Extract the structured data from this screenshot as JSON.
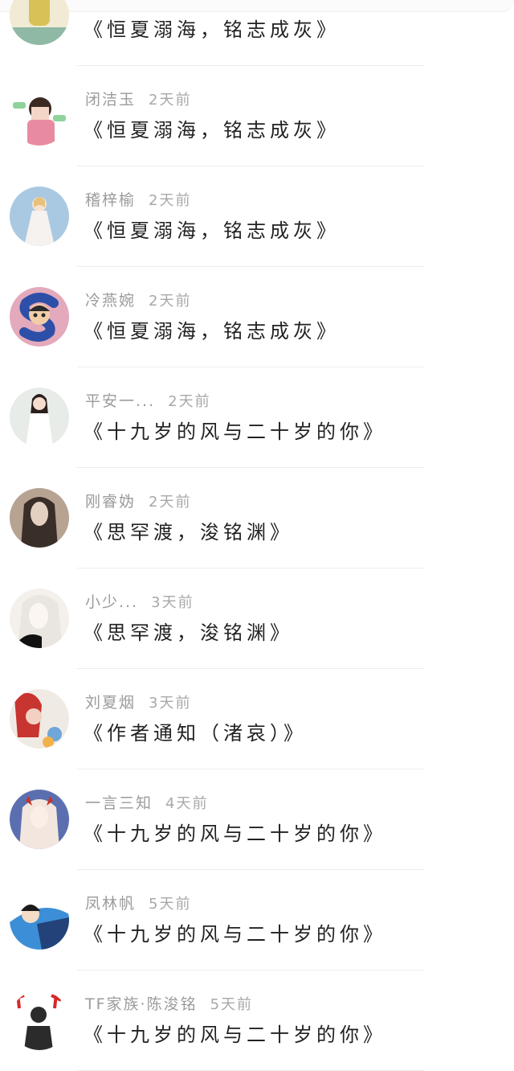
{
  "items": [
    {
      "name": "",
      "time": "",
      "title": "《恒夏溺海，铭志成灰》",
      "avatar": "green-shirt-person-avatar",
      "colors": [
        "#8fb9a4",
        "#d8c257",
        "#f1ead4"
      ]
    },
    {
      "name": "闭洁玉",
      "time": "2天前",
      "title": "《恒夏溺海，铭志成灰》",
      "avatar": "stickered-boy-avatar",
      "colors": [
        "#ffffff",
        "#e88aa0",
        "#3b2a22"
      ]
    },
    {
      "name": "稽梓榆",
      "time": "2天前",
      "title": "《恒夏溺海，铭志成灰》",
      "avatar": "anime-girl-white-dress-avatar",
      "colors": [
        "#a9c9e2",
        "#f5f2ef",
        "#e8c27d"
      ]
    },
    {
      "name": "冷燕婉",
      "time": "2天前",
      "title": "《恒夏溺海，铭志成灰》",
      "avatar": "cartoon-s-badge-avatar",
      "colors": [
        "#e3aabb",
        "#2d4fa8",
        "#2a2a2a"
      ]
    },
    {
      "name": "平安一...",
      "time": "2天前",
      "title": "《十九岁的风与二十岁的你》",
      "avatar": "woman-white-dress-avatar",
      "colors": [
        "#e8ece9",
        "#ffffff",
        "#2a1f1a"
      ]
    },
    {
      "name": "刚睿妫",
      "time": "2天前",
      "title": "《思罕渡，浚铭渊》",
      "avatar": "dark-hair-woman-avatar",
      "colors": [
        "#b7a392",
        "#3a2e29",
        "#e4d0c0"
      ]
    },
    {
      "name": "小少...",
      "time": "3天前",
      "title": "《思罕渡，浚铭渊》",
      "avatar": "white-hair-anime-avatar",
      "colors": [
        "#f4f1ec",
        "#e9e6e0",
        "#111111"
      ]
    },
    {
      "name": "刘夏烟",
      "time": "3天前",
      "title": "《作者通知（渚哀）》",
      "avatar": "red-hair-girl-avatar",
      "colors": [
        "#f0eae4",
        "#c8342f",
        "#6fa7d8"
      ]
    },
    {
      "name": "一言三知",
      "time": "4天前",
      "title": "《十九岁的风与二十岁的你》",
      "avatar": "fantasy-anime-girl-avatar",
      "colors": [
        "#5b6fb0",
        "#f3e6de",
        "#c8332b"
      ]
    },
    {
      "name": "凤林帆",
      "time": "5天前",
      "title": "《十九岁的风与二十岁的你》",
      "avatar": "detective-cartoon-avatar",
      "colors": [
        "#3c8fd6",
        "#24427a",
        "#ffffff"
      ]
    },
    {
      "name": "TF家族·陈浚铭",
      "time": "5天前",
      "title": "《十九岁的风与二十岁的你》",
      "avatar": "calligraphy-person-avatar",
      "colors": [
        "#ffffff",
        "#2b2b2b",
        "#d62828"
      ]
    }
  ]
}
